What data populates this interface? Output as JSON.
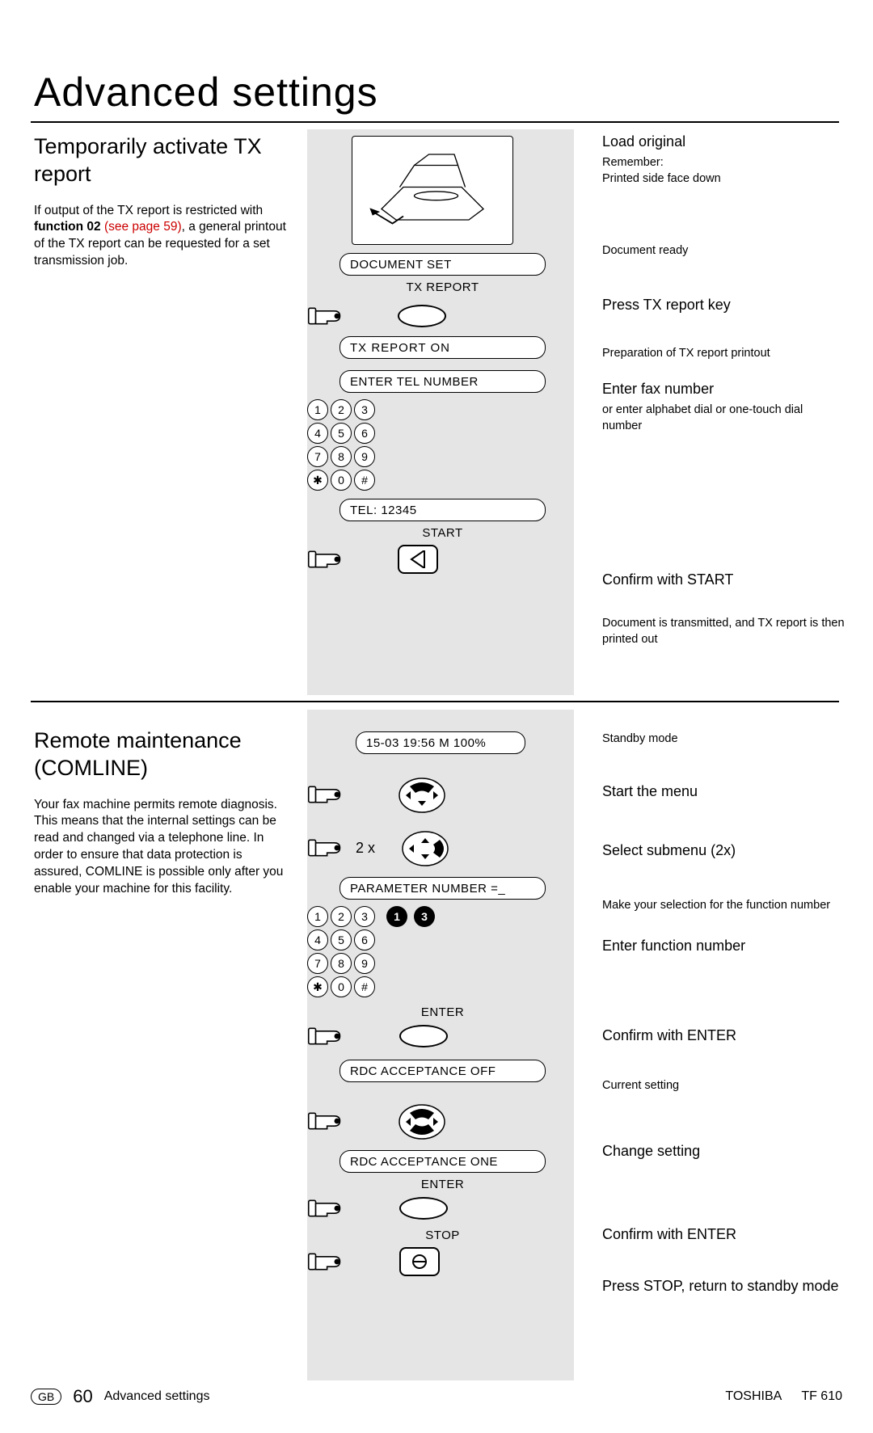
{
  "page_title": "Advanced settings",
  "section1": {
    "heading": "Temporarily activate TX report",
    "body_pre": "If output of the TX report is restricted with ",
    "body_bold": "function 02",
    "body_link": " (see page 59)",
    "body_post": ", a general printout of the TX report can be requested for a set transmission job.",
    "lcd_document_set": "DOCUMENT SET",
    "label_tx_report": "TX REPORT",
    "lcd_tx_report_on": "TX REPORT     ON",
    "lcd_enter_tel": "ENTER TEL NUMBER",
    "lcd_tel": "TEL: 12345",
    "label_start": "START",
    "r1_h": "Load original",
    "r1_sub1": "Remember:",
    "r1_sub2": "Printed side face down",
    "r1_sub3": "Document ready",
    "r2_h": "Press TX report key",
    "r2_sub": "Preparation of TX report printout",
    "r3_h": "Enter fax number",
    "r3_sub": "or enter alphabet dial or one-touch dial number",
    "r4_h": "Confirm with START",
    "r4_sub": "Document is transmitted, and TX report is then printed out"
  },
  "section2": {
    "heading": "Remote maintenance (COMLINE)",
    "body": "Your fax machine permits remote diagnosis. This means that the internal settings can be read and changed via a telephone line. In order to ensure that data protection is assured, COMLINE is possible only after you enable your machine for this facility.",
    "lcd_standby": "15-03 19:56  M 100%",
    "count_2x": "2 x",
    "lcd_param": "PARAMETER NUMBER =_",
    "d1": "1",
    "d3": "3",
    "label_enter": "ENTER",
    "lcd_rdc_off": "RDC ACCEPTANCE   OFF",
    "lcd_rdc_one": "RDC ACCEPTANCE   ONE",
    "label_stop": "STOP",
    "r1": "Standby mode",
    "r2": "Start the menu",
    "r3": "Select submenu (2x)",
    "r4": "Make your selection for the function number",
    "r5": "Enter function number",
    "r6": "Confirm with ENTER",
    "r7": "Current setting",
    "r8": "Change setting",
    "r9": "Confirm with ENTER",
    "r10": "Press STOP, return to standby mode"
  },
  "keypad": [
    "1",
    "2",
    "3",
    "4",
    "5",
    "6",
    "7",
    "8",
    "9",
    "✱",
    "0",
    "#"
  ],
  "footer": {
    "gb": "GB",
    "page": "60",
    "chapter": "Advanced settings",
    "brand": "TOSHIBA",
    "model": "TF 610"
  }
}
